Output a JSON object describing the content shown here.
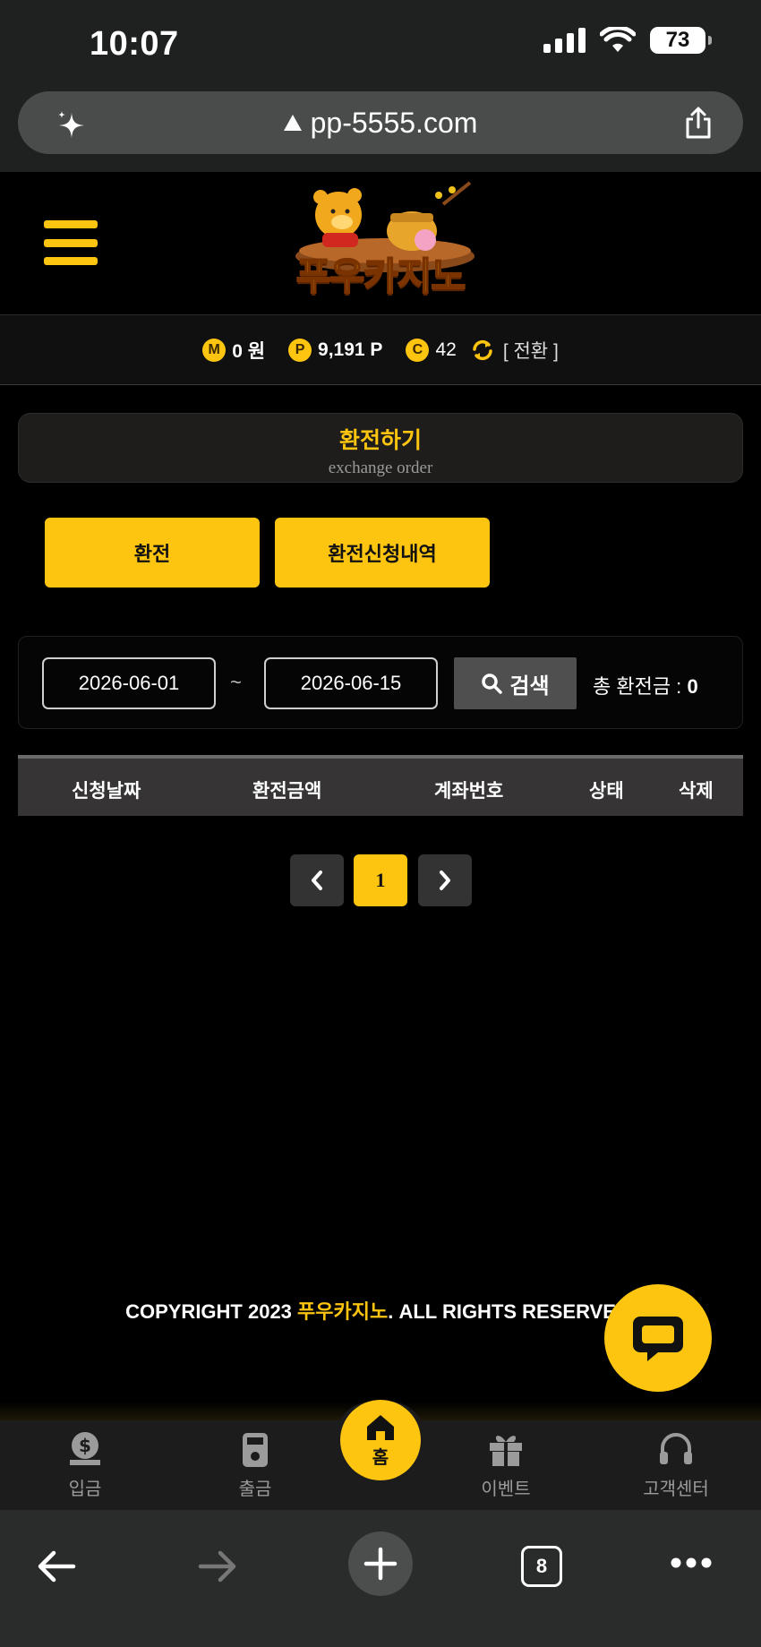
{
  "status_bar": {
    "time": "10:07",
    "battery": "73"
  },
  "browser": {
    "url": "pp-5555.com",
    "tab_count": "8"
  },
  "site": {
    "logo_text": "푸우카지노",
    "balance": {
      "money_badge": "M",
      "money": "0 원",
      "point_badge": "P",
      "point": "9,191 P",
      "coin_badge": "C",
      "coin": "42",
      "convert_label": "[ 전환 ]"
    }
  },
  "section": {
    "title": "환전하기",
    "subtitle": "exchange order"
  },
  "buttons": {
    "exchange": "환전",
    "history": "환전신청내역"
  },
  "search": {
    "date_from": "2026-06-01",
    "separator": "~",
    "date_to": "2026-06-15",
    "search_label": "검색",
    "total_label": "총 환전금 :",
    "total_value": "0"
  },
  "table": {
    "columns": [
      "신청날짜",
      "환전금액",
      "계좌번호",
      "상태",
      "삭제"
    ]
  },
  "pagination": {
    "current": "1"
  },
  "footer": {
    "copyright_prefix": "COPYRIGHT 2023 ",
    "brand": "푸우카지노",
    "copyright_suffix": ". ALL RIGHTS RESERVED."
  },
  "bottom_nav": {
    "deposit": "입금",
    "withdraw": "출금",
    "home": "홈",
    "event": "이벤트",
    "support": "고객센터"
  },
  "colors": {
    "accent": "#fdc50f",
    "background": "#000000",
    "panel": "#1e1d1b"
  }
}
